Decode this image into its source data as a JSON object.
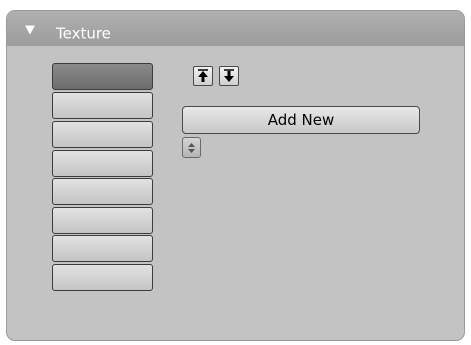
{
  "panel": {
    "title": "Texture",
    "collapse_icon": "triangle-down-icon"
  },
  "texture_slots": {
    "count": 8,
    "active_index": 0
  },
  "toolbar": {
    "move_up_icon": "arrow-up-icon",
    "move_down_icon": "arrow-down-icon",
    "add_new_label": "Add New",
    "browse_icon": "up-down-spinner-icon"
  },
  "colors": {
    "panel_bg": "#c3c3c3",
    "header_bg": "#a6a6a6",
    "active_slot": "#787878"
  }
}
